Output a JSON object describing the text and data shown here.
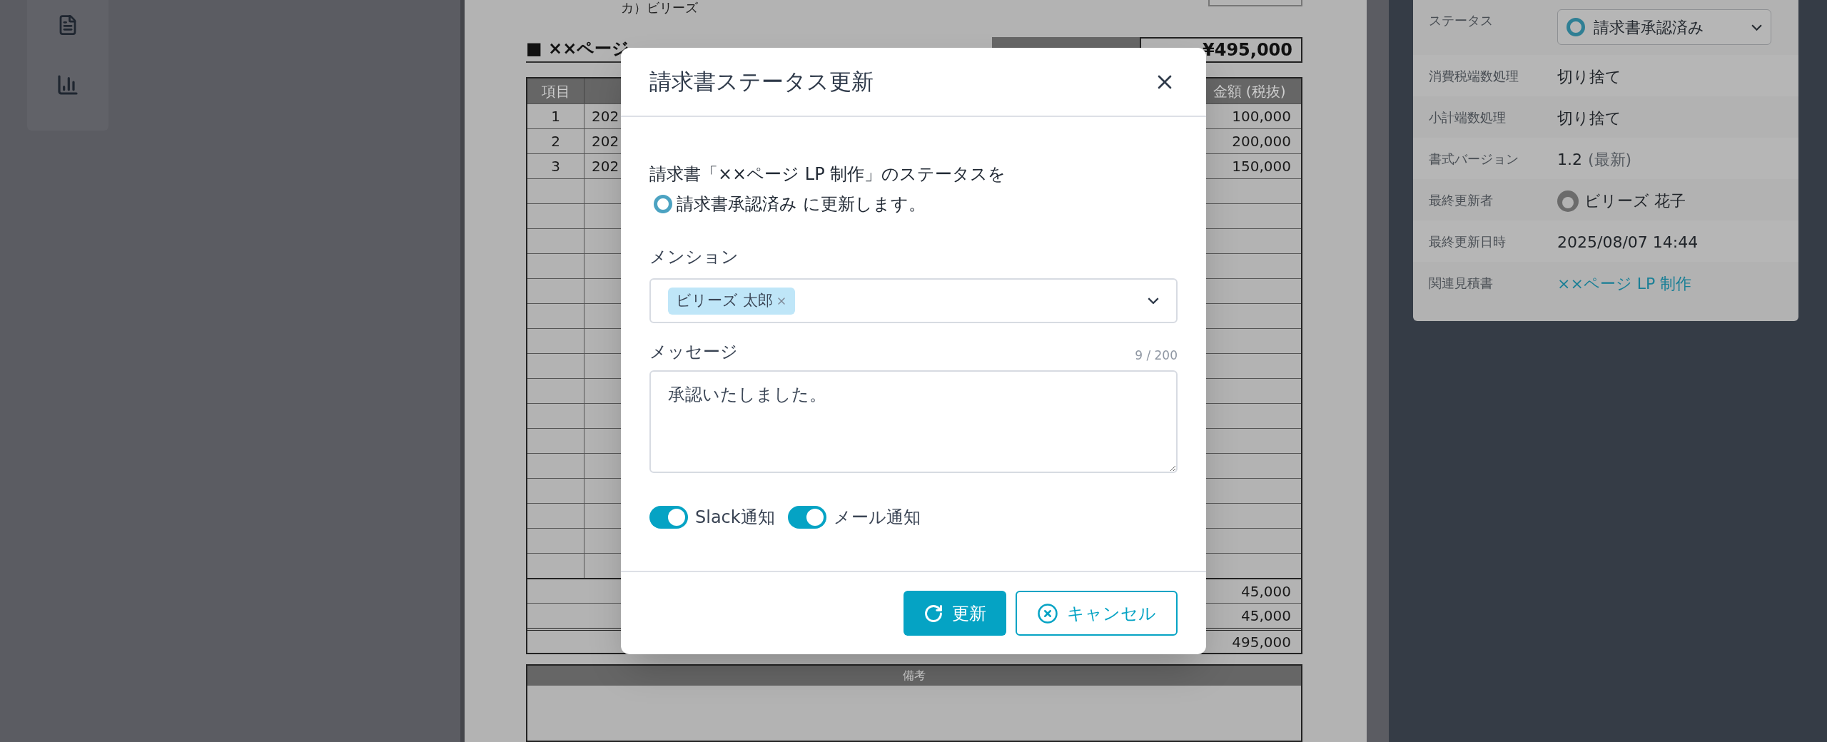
{
  "document": {
    "company": "カ）ビリーズ",
    "title": "■ ××ページ",
    "total": "¥495,000",
    "table": {
      "columns": [
        "項目"
      ],
      "amount_column": "金額 (税抜)",
      "rows": [
        {
          "item": "1",
          "date": "202",
          "amount": "100,000"
        },
        {
          "item": "2",
          "date": "202",
          "amount": "200,000"
        },
        {
          "item": "3",
          "date": "202",
          "amount": "150,000"
        }
      ],
      "summary": [
        "45,000",
        "45,000",
        "495,000"
      ]
    },
    "remarks_header": "備考"
  },
  "details_panel": {
    "rows": [
      {
        "label": "ステータス",
        "kind": "status",
        "value": "請求書承認済み"
      },
      {
        "label": "消費税端数処理",
        "kind": "text",
        "value": "切り捨て"
      },
      {
        "label": "小計端数処理",
        "kind": "text",
        "value": "切り捨て"
      },
      {
        "label": "書式バージョン",
        "kind": "version",
        "value": "1.2",
        "note": "(最新)"
      },
      {
        "label": "最終更新者",
        "kind": "user",
        "value": "ビリーズ 花子"
      },
      {
        "label": "最終更新日時",
        "kind": "text",
        "value": "2025/08/07 14:44"
      },
      {
        "label": "関連見積書",
        "kind": "link",
        "value": "××ページ LP 制作"
      }
    ]
  },
  "dialog": {
    "title": "請求書ステータス更新",
    "message": "請求書「××ページ LP 制作」のステータスを",
    "status_line": "請求書承認済み に更新します。",
    "mention": {
      "label": "メンション",
      "chips": [
        "ビリーズ 太郎"
      ]
    },
    "message_field": {
      "label": "メッセージ",
      "counter": "9 / 200",
      "value": "承認いたしました。"
    },
    "toggles": [
      {
        "label": "Slack通知",
        "on": true
      },
      {
        "label": "メール通知",
        "on": true
      }
    ],
    "buttons": [
      {
        "label": "更新",
        "kind": "primary"
      },
      {
        "label": "キャンセル",
        "kind": "secondary"
      }
    ]
  }
}
